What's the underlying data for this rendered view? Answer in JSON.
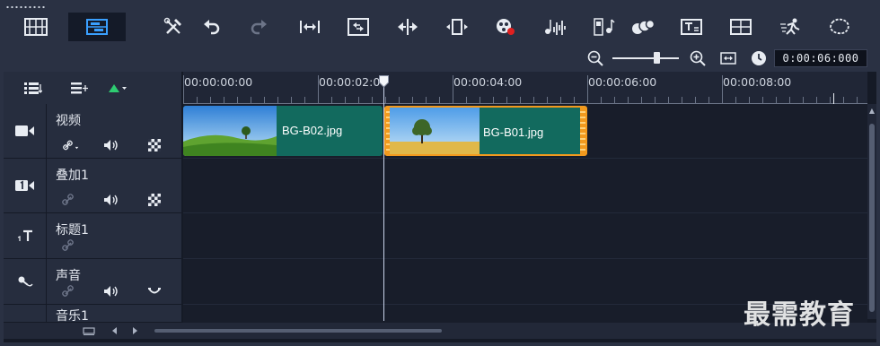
{
  "toolbar": {
    "buttons": [
      {
        "name": "storyboard-view",
        "icon": "film-strip-icon",
        "active": false
      },
      {
        "name": "timeline-view",
        "icon": "timeline-view-icon",
        "active": true
      },
      {
        "name": "tools",
        "icon": "tools-icon"
      },
      {
        "name": "undo",
        "icon": "undo-icon"
      },
      {
        "name": "redo",
        "icon": "redo-icon"
      },
      {
        "name": "fit-to-window",
        "icon": "fit-width-icon"
      },
      {
        "name": "smart-proxy",
        "icon": "proxy-icon"
      },
      {
        "name": "split",
        "icon": "split-icon"
      },
      {
        "name": "resize",
        "icon": "resize-icon"
      },
      {
        "name": "record-capture",
        "icon": "record-icon"
      },
      {
        "name": "audio-mixer",
        "icon": "audio-mixer-icon"
      },
      {
        "name": "auto-music",
        "icon": "auto-music-icon"
      },
      {
        "name": "motion-tracking",
        "icon": "motion-tracking-icon"
      },
      {
        "name": "subtitle-editor",
        "icon": "subtitle-icon"
      },
      {
        "name": "multi-camera",
        "icon": "multi-camera-icon"
      },
      {
        "name": "time-remapping",
        "icon": "time-remap-icon"
      },
      {
        "name": "mask-creator",
        "icon": "mask-icon"
      }
    ]
  },
  "zoom": {
    "timecode": "0:00:06:000",
    "level": 0.68
  },
  "ruler": {
    "labels": [
      "00:00:00:00",
      "00:00:02:00",
      "00:00:04:00",
      "00:00:06:00",
      "00:00:08:00"
    ]
  },
  "tracks": [
    {
      "name": "视频",
      "icon": "video-track-icon"
    },
    {
      "name": "叠加1",
      "icon": "overlay-track-icon"
    },
    {
      "name": "标题1",
      "icon": "title-track-icon"
    },
    {
      "name": "声音",
      "icon": "voice-track-icon"
    },
    {
      "name": "音乐1",
      "icon": "music-track-icon"
    }
  ],
  "clips": [
    {
      "label": "BG-B02.jpg",
      "selected": false
    },
    {
      "label": "BG-B01.jpg",
      "selected": true
    }
  ],
  "colors": {
    "clip": "#126a5e",
    "selection": "#f29a1e",
    "active_tab": "#3aa0ff",
    "add_green": "#2ecc71"
  },
  "watermark": "最需教育"
}
